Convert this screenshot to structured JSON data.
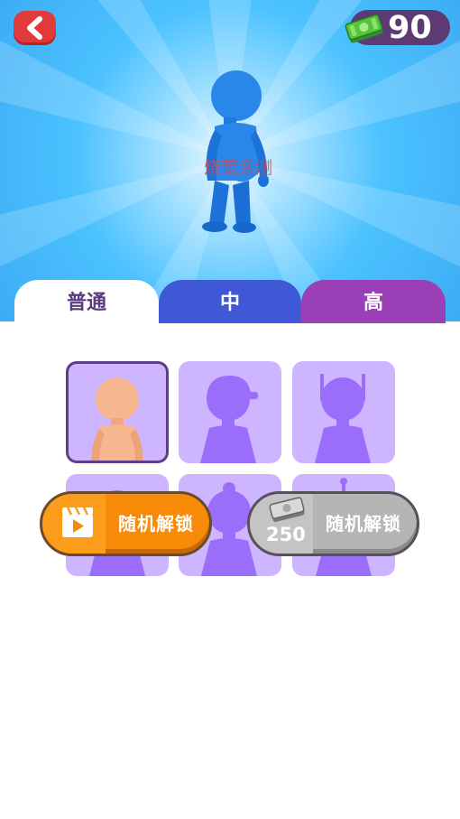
{
  "header": {
    "back_icon": "chevron-left-icon",
    "currency_icon": "cash-stack-icon",
    "currency_amount": "90"
  },
  "preview": {
    "watermark_text": "烧荒亲测"
  },
  "tabs": [
    {
      "label": "普通",
      "active": true,
      "color": "#ffffff"
    },
    {
      "label": "中",
      "active": false,
      "color": "#3f58d6"
    },
    {
      "label": "高",
      "active": false,
      "color": "#9b3fb7"
    }
  ],
  "skins": [
    {
      "state": "unlocked",
      "selected": true
    },
    {
      "state": "locked",
      "hat": "cap"
    },
    {
      "state": "locked",
      "hat": "horns"
    },
    {
      "state": "locked",
      "hat": "none"
    },
    {
      "state": "locked",
      "hat": "bun"
    },
    {
      "state": "locked",
      "hat": "antenna"
    }
  ],
  "actions": {
    "video_unlock": {
      "label": "随机解锁",
      "icon": "video-icon",
      "color": "#f78a07"
    },
    "coin_unlock": {
      "label": "随机解锁",
      "icon": "cash-stack-icon",
      "price": "250",
      "color": "#b5b5b5"
    }
  }
}
